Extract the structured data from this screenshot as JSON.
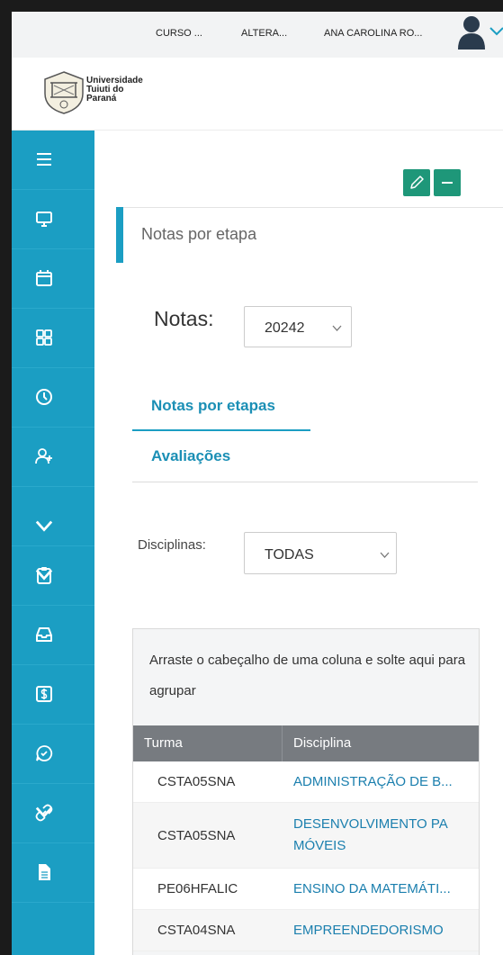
{
  "topbar": {
    "course": "CURSO ...",
    "change": "ALTERA...",
    "user_name": "ANA CAROLINA RO..."
  },
  "logo": {
    "line1": "Universidade",
    "line2": "Tuiuti do",
    "line3": "Paraná"
  },
  "sidebar": {
    "items": [
      {
        "icon": "menu-icon"
      },
      {
        "icon": "monitor-icon"
      },
      {
        "icon": "calendar-icon"
      },
      {
        "icon": "grid-icon"
      },
      {
        "icon": "clock-icon"
      },
      {
        "icon": "user-add-icon"
      },
      {
        "icon": "chevron-down-icon"
      },
      {
        "icon": "clipboard-icon"
      },
      {
        "icon": "inbox-icon"
      },
      {
        "icon": "dollar-icon"
      },
      {
        "icon": "chat-icon"
      },
      {
        "icon": "link-icon"
      },
      {
        "icon": "document-icon"
      }
    ]
  },
  "section": {
    "title": "Notas por etapa"
  },
  "notas": {
    "label": "Notas:",
    "selected": "20242"
  },
  "tabs": [
    {
      "label": "Notas por etapas",
      "active": true
    },
    {
      "label": "Avaliações",
      "active": false
    }
  ],
  "filter": {
    "label": "Disciplinas:",
    "selected": "TODAS"
  },
  "grid": {
    "group_hint": "Arraste o cabeçalho de uma coluna e solte aqui para agrupar",
    "columns": [
      "Turma",
      "Disciplina"
    ],
    "rows": [
      {
        "turma": "CSTA05SNA",
        "disciplina": "ADMINISTRAÇÃO DE B..."
      },
      {
        "turma": "CSTA05SNA",
        "disciplina_l1": "DESENVOLVIMENTO PA",
        "disciplina_l2": "MÓVEIS"
      },
      {
        "turma": "PE06HFALIC",
        "disciplina": "ENSINO DA MATEMÁTI..."
      },
      {
        "turma": "CSTA04SNA",
        "disciplina": "EMPREENDEDORISMO"
      }
    ]
  },
  "colors": {
    "sidebar": "#1b9ec3",
    "accent_button": "#1e9779",
    "link": "#1b7fae",
    "grid_header": "#777b80"
  }
}
